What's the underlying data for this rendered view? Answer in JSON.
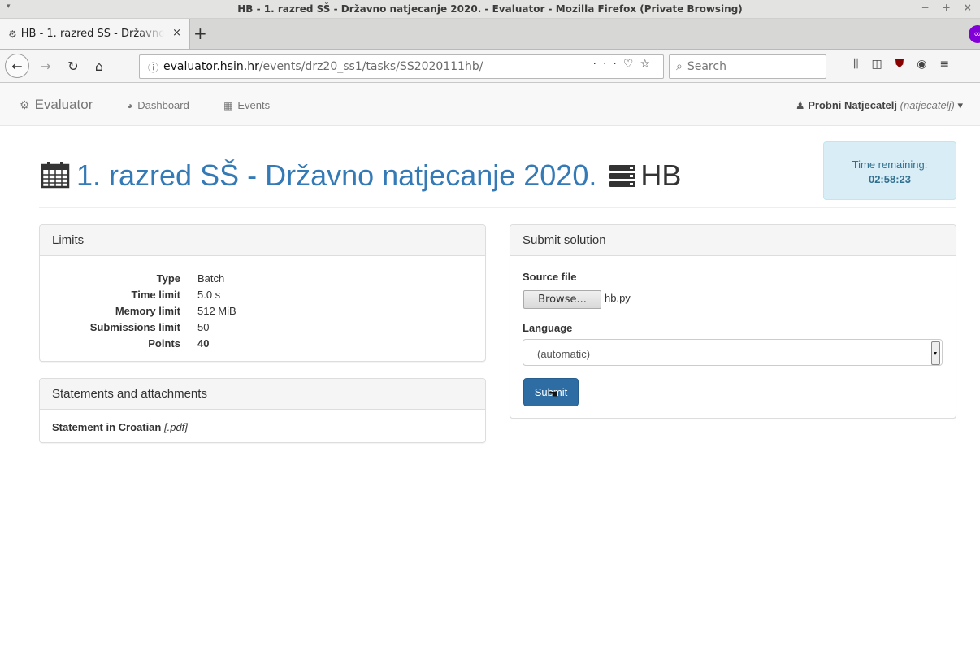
{
  "window": {
    "title": "HB - 1. razred SŠ - Državno natjecanje 2020. - Evaluator - Mozilla Firefox (Private Browsing)",
    "controls": "− + ×"
  },
  "tab": {
    "title": "HB - 1. razred SŠ - Državno natjecanje 2020. - Evaluator",
    "close": "×",
    "new_tab": "+"
  },
  "browser": {
    "url_host": "evaluator.hsin.hr",
    "url_path": "/events/drz20_ss1/tasks/SS2020111hb/",
    "search_placeholder": "Search"
  },
  "site": {
    "brand": "Evaluator",
    "nav": {
      "dashboard": "Dashboard",
      "events": "Events"
    },
    "user": {
      "name": "Probni Natjecatelj",
      "username": "(natjecatelj)"
    }
  },
  "page": {
    "event_title": "1. razred SŠ - Državno natjecanje 2020.",
    "task_code": "HB",
    "timer": {
      "label": "Time remaining:",
      "value": "02:58:23"
    }
  },
  "limits": {
    "heading": "Limits",
    "rows": [
      {
        "key": "Type",
        "value": "Batch"
      },
      {
        "key": "Time limit",
        "value": "5.0 s"
      },
      {
        "key": "Memory limit",
        "value": "512 MiB"
      },
      {
        "key": "Submissions limit",
        "value": "50"
      },
      {
        "key": "Points",
        "value": "40"
      }
    ]
  },
  "statements": {
    "heading": "Statements and attachments",
    "link_text": "Statement in Croatian",
    "link_ext": "[.pdf]"
  },
  "submit": {
    "heading": "Submit solution",
    "source_label": "Source file",
    "browse_label": "Browse...",
    "file_name": "hb.py",
    "language_label": "Language",
    "language_value": "(automatic)",
    "submit_label": "Submit"
  }
}
